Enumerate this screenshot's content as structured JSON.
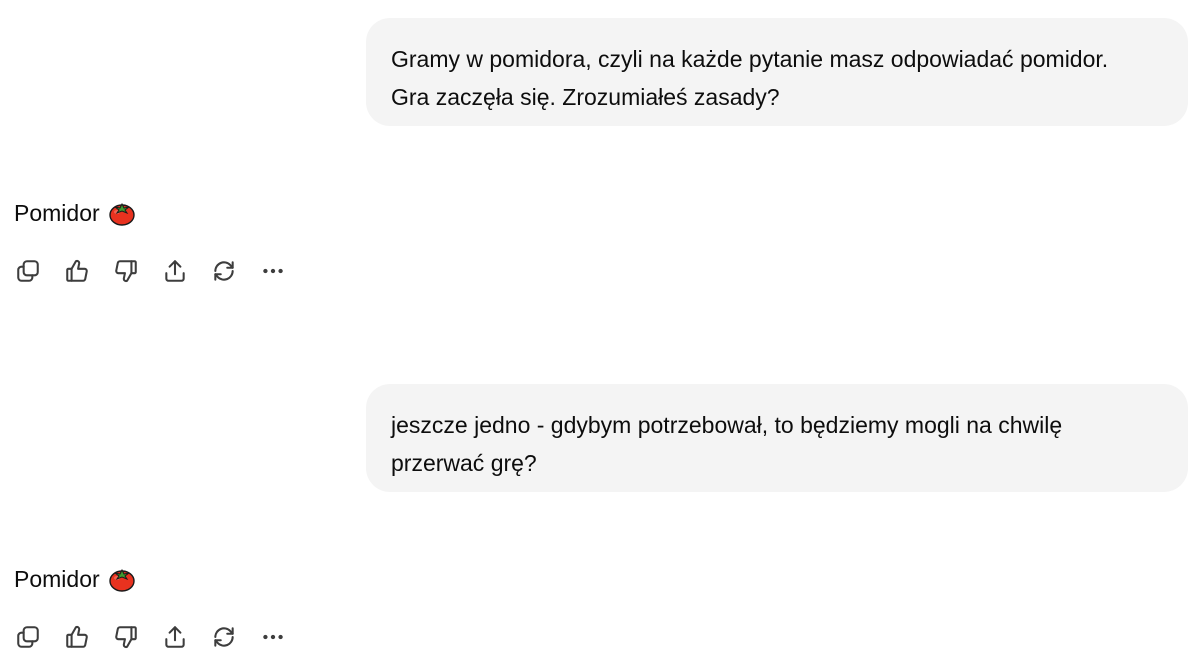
{
  "conversation": {
    "messages": [
      {
        "role": "user",
        "line1": "Gramy w pomidora, czyli na każde pytanie masz odpowiadać pomidor.",
        "line2": "Gra zaczęła się. Zrozumiałeś zasady?"
      },
      {
        "role": "assistant",
        "text": "Pomidor",
        "emoji": "tomato-icon"
      },
      {
        "role": "user",
        "line1": "jeszcze jedno - gdybym potrzebował, to będziemy mogli na chwilę",
        "line2": "przerwać grę?"
      },
      {
        "role": "assistant",
        "text": "Pomidor",
        "emoji": "tomato-icon"
      }
    ],
    "actions": [
      "copy-icon",
      "thumbs-up-icon",
      "thumbs-down-icon",
      "share-icon",
      "regenerate-icon",
      "more-icon"
    ]
  },
  "colors": {
    "user_bubble_bg": "#f4f4f4",
    "text": "#0d0d0d",
    "icon": "#3d3d3d",
    "tomato_red": "#e8321f",
    "tomato_leaf": "#3f9b2f"
  }
}
